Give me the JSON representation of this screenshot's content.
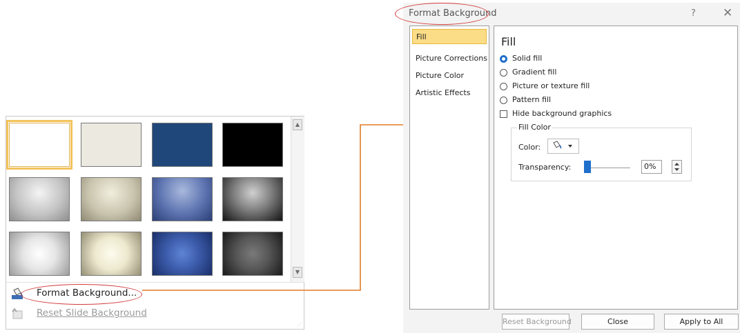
{
  "gallery": {
    "swatches": [
      {
        "name": "white",
        "bg": "#ffffff"
      },
      {
        "name": "cream",
        "bg": "#ece9e0"
      },
      {
        "name": "navy",
        "bg": "#20477a"
      },
      {
        "name": "black",
        "bg": "#000000"
      },
      {
        "name": "silver-gradient",
        "bg": "radial-gradient(ellipse at 50% 35%, #f4f4f4 0%, #c4c4c4 55%, #8e8e8e 100%)"
      },
      {
        "name": "sand-gradient",
        "bg": "radial-gradient(ellipse at 50% 35%, #f0eede 0%, #c9c4ad 55%, #908a74 100%)"
      },
      {
        "name": "blue-gradient",
        "bg": "radial-gradient(ellipse at 50% 30%, #a9b9dd 0%, #5c73b0 55%, #2b3f75 100%)"
      },
      {
        "name": "charcoal-gradient",
        "bg": "radial-gradient(ellipse at 50% 35%, #d0d0d0 0%, #7f7f7f 45%, #141414 100%)"
      },
      {
        "name": "silver-glow",
        "bg": "radial-gradient(circle at 50% 50%, #ffffff 0%, #e5e5e5 45%, #9c9c9c 100%)"
      },
      {
        "name": "cream-glow",
        "bg": "radial-gradient(circle at 50% 50%, #fdfbee 0%, #ede9cf 45%, #958f75 100%)"
      },
      {
        "name": "blue-glow",
        "bg": "radial-gradient(circle at 50% 50%, #5f84d4 0%, #3c5cab 45%, #1a2f69 100%)"
      },
      {
        "name": "grey-glow",
        "bg": "radial-gradient(circle at 50% 50%, #7a7a7a 0%, #565656 45%, #1a1a1a 100%)"
      }
    ],
    "format_background_label": "Format Background...",
    "reset_label": "Reset Slide Background"
  },
  "dialog": {
    "title": "Format Background",
    "help": "?",
    "close": "✕",
    "nav": [
      "Fill",
      "Picture Corrections",
      "Picture Color",
      "Artistic Effects"
    ],
    "heading": "Fill",
    "options": [
      {
        "label": "Solid fill",
        "type": "radio",
        "selected": true
      },
      {
        "label": "Gradient fill",
        "type": "radio",
        "selected": false
      },
      {
        "label": "Picture or texture fill",
        "type": "radio",
        "selected": false
      },
      {
        "label": "Pattern fill",
        "type": "radio",
        "selected": false
      },
      {
        "label": "Hide background graphics",
        "type": "checkbox",
        "selected": false
      }
    ],
    "fill_color_group": "Fill Color",
    "color_label": "Color:",
    "transparency_label": "Transparency:",
    "transparency_value": "0%",
    "buttons": {
      "reset": "Reset Background",
      "close": "Close",
      "apply": "Apply to All"
    }
  },
  "colors": {
    "accent": "#1f6fcb",
    "selection": "#fbdd87",
    "annotation": "#d43b3b",
    "arrow": "#e07a24"
  }
}
